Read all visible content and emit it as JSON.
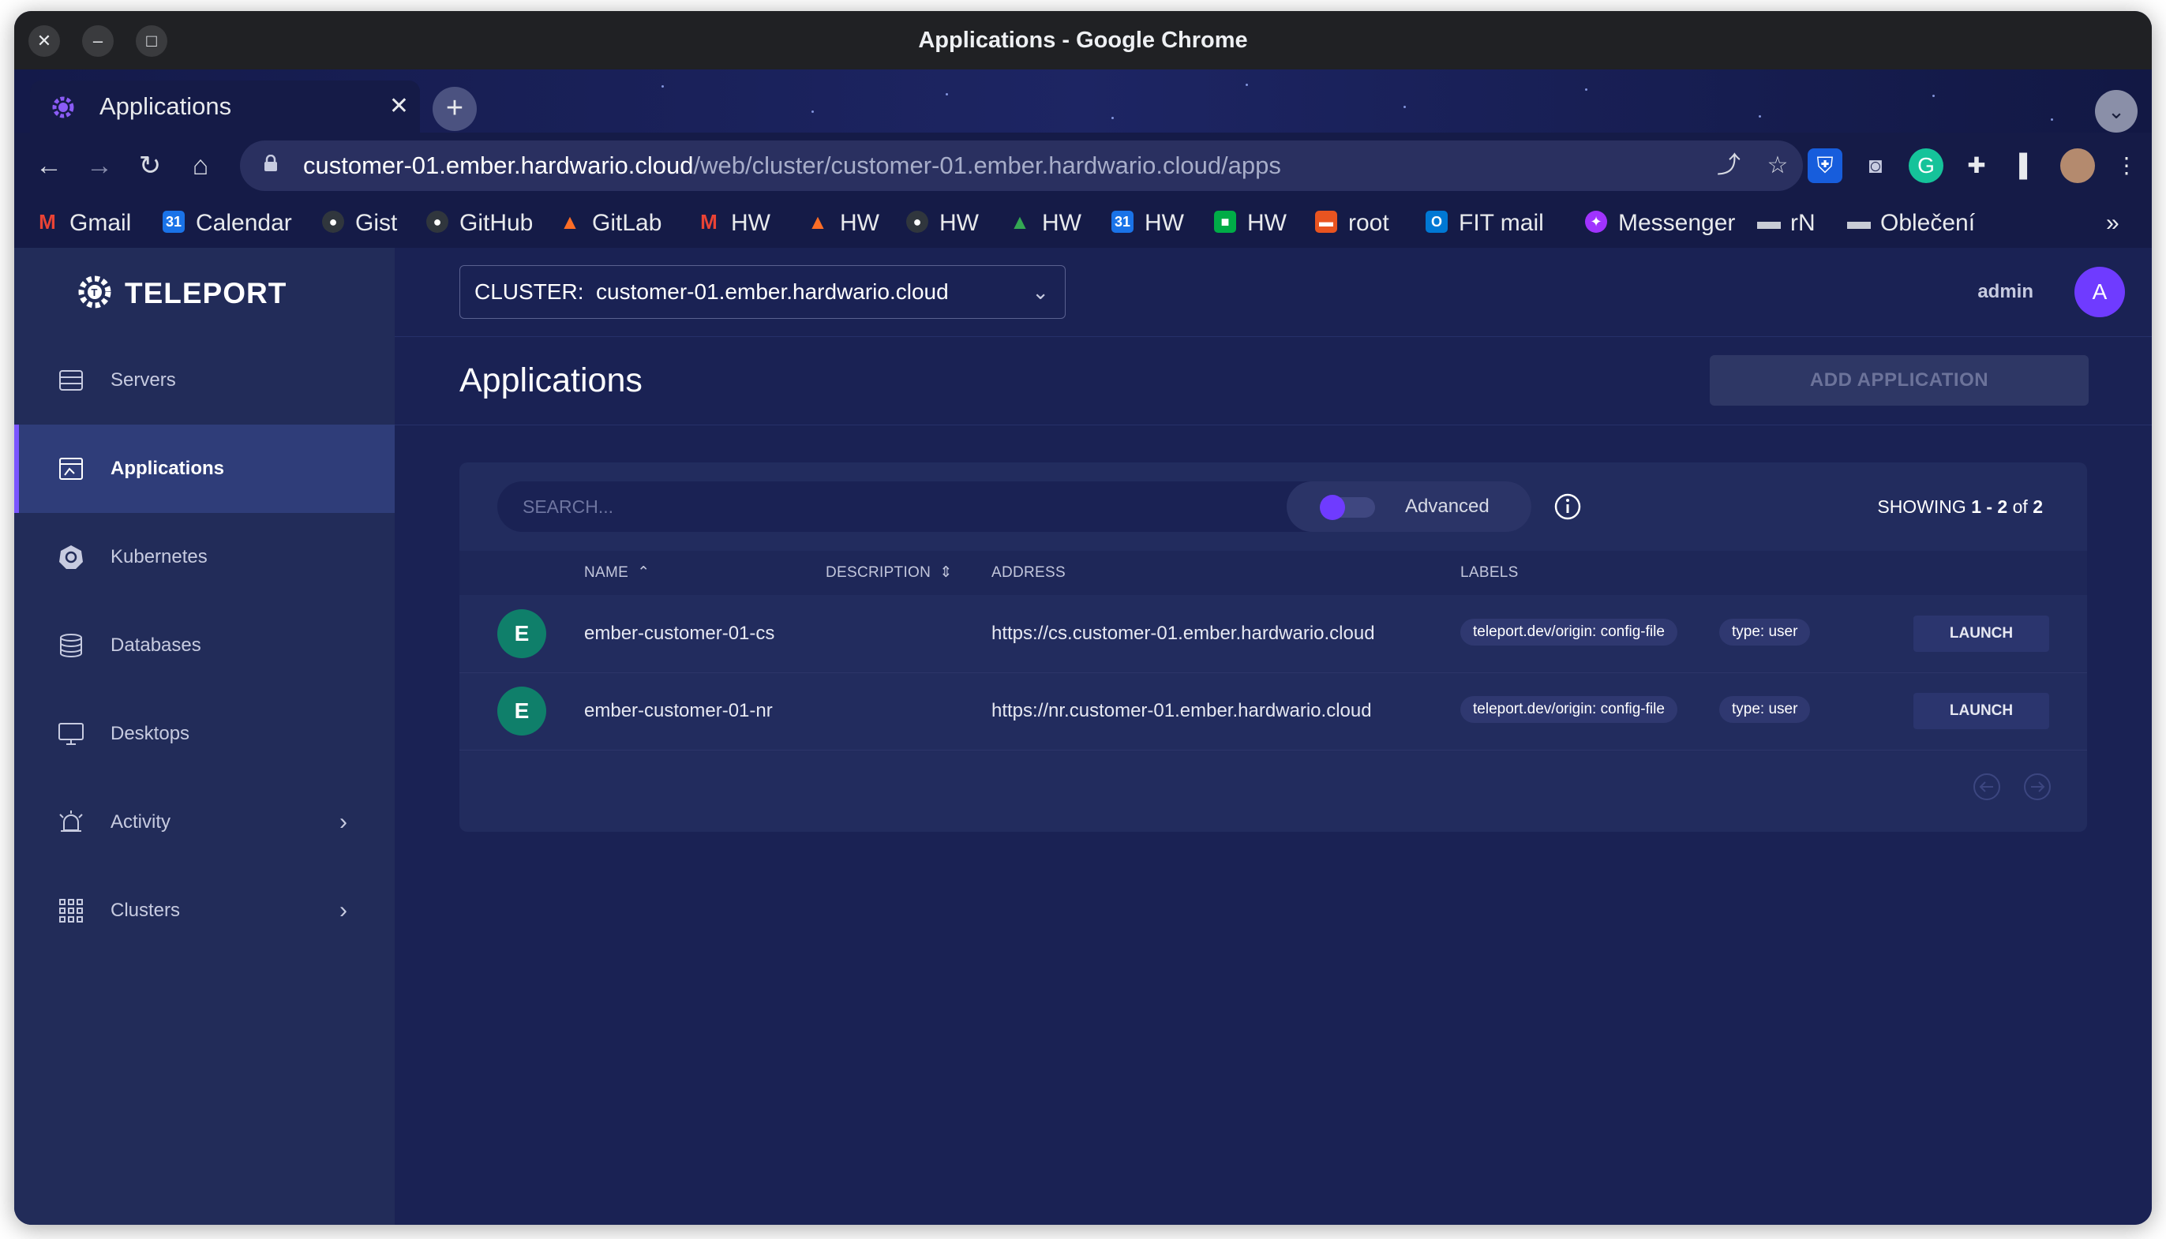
{
  "window": {
    "title": "Applications - Google Chrome"
  },
  "tab": {
    "label": "Applications"
  },
  "address_bar": {
    "host": "customer-01.ember.hardwario.cloud",
    "path": "/web/cluster/customer-01.ember.hardwario.cloud/apps"
  },
  "bookmarks": [
    {
      "label": "Gmail",
      "icon": "gmail-icon",
      "color": "#ea4335"
    },
    {
      "label": "Calendar",
      "icon": "calendar-icon",
      "color": "#1a73e8"
    },
    {
      "label": "Gist",
      "icon": "github-icon",
      "color": "#30363d"
    },
    {
      "label": "GitHub",
      "icon": "github-icon",
      "color": "#30363d"
    },
    {
      "label": "GitLab",
      "icon": "gitlab-icon",
      "color": "#fc6d26"
    },
    {
      "label": "HW",
      "icon": "gmail-icon",
      "color": "#ea4335"
    },
    {
      "label": "HW",
      "icon": "gitlab-icon",
      "color": "#fc6d26"
    },
    {
      "label": "HW",
      "icon": "github-icon",
      "color": "#30363d"
    },
    {
      "label": "HW",
      "icon": "drive-icon",
      "color": "#34a853"
    },
    {
      "label": "HW",
      "icon": "calendar-icon",
      "color": "#1a73e8"
    },
    {
      "label": "HW",
      "icon": "chat-icon",
      "color": "#00ac47"
    },
    {
      "label": "root",
      "icon": "terminal-icon",
      "color": "#e95420"
    },
    {
      "label": "FIT mail",
      "icon": "outlook-icon",
      "color": "#0078d4"
    },
    {
      "label": "Messenger",
      "icon": "messenger-icon",
      "color": "#a033ff"
    },
    {
      "label": "rN",
      "icon": "folder-icon",
      "color": "#c8ccd6"
    },
    {
      "label": "Oblečení",
      "icon": "folder-icon",
      "color": "#c8ccd6"
    }
  ],
  "sidebar": {
    "brand": "TELEPORT",
    "items": [
      {
        "label": "Servers",
        "icon": "server-icon"
      },
      {
        "label": "Applications",
        "icon": "application-icon",
        "active": true
      },
      {
        "label": "Kubernetes",
        "icon": "kubernetes-icon"
      },
      {
        "label": "Databases",
        "icon": "database-icon"
      },
      {
        "label": "Desktops",
        "icon": "desktop-icon"
      },
      {
        "label": "Activity",
        "icon": "alarm-icon",
        "expandable": true
      },
      {
        "label": "Clusters",
        "icon": "grid-icon",
        "expandable": true
      }
    ]
  },
  "topbar": {
    "cluster_label": "CLUSTER:",
    "cluster_value": "customer-01.ember.hardwario.cloud",
    "username": "admin",
    "avatar_initial": "A"
  },
  "page": {
    "title": "Applications",
    "add_button": "ADD APPLICATION"
  },
  "search": {
    "placeholder": "SEARCH...",
    "advanced_label": "Advanced",
    "advanced_enabled": false,
    "showing_prefix": "SHOWING",
    "showing_range": "1 - 2",
    "showing_of": "of",
    "showing_total": "2"
  },
  "table": {
    "columns": {
      "name": "NAME",
      "description": "DESCRIPTION",
      "address": "ADDRESS",
      "labels": "LABELS"
    },
    "rows": [
      {
        "initial": "E",
        "name": "ember-customer-01-cs",
        "description": "",
        "address": "https://cs.customer-01.ember.hardwario.cloud",
        "labels": [
          "teleport.dev/origin: config-file",
          "type: user"
        ],
        "action": "LAUNCH"
      },
      {
        "initial": "E",
        "name": "ember-customer-01-nr",
        "description": "",
        "address": "https://nr.customer-01.ember.hardwario.cloud",
        "labels": [
          "teleport.dev/origin: config-file",
          "type: user"
        ],
        "action": "LAUNCH"
      }
    ]
  },
  "colors": {
    "accent": "#6f3bff",
    "app_background": "#1a2254",
    "sidebar_background": "#222c59",
    "badge": "#0f7f6a"
  }
}
